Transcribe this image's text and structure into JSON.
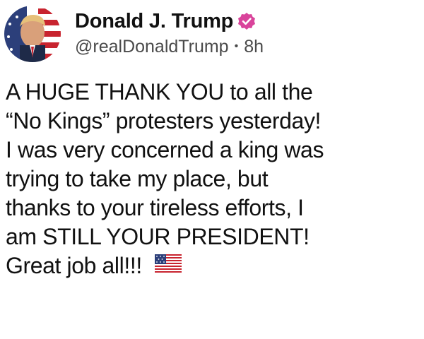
{
  "post": {
    "author": {
      "display_name": "Donald J. Trump",
      "handle": "@realDonaldTrump",
      "time_ago": "8h",
      "separator": "•",
      "verified": true,
      "verified_badge_color": "#d9449b",
      "avatar_icon": "profile-picture"
    },
    "body_lines": [
      "A HUGE THANK YOU to all the",
      "“No Kings” protesters yesterday!",
      "I was very concerned a king was",
      "trying to take my place, but",
      "thanks to your tireless efforts, I",
      "am STILL YOUR PRESIDENT!",
      "Great job all!!!"
    ],
    "emoji": "us-flag-emoji"
  }
}
